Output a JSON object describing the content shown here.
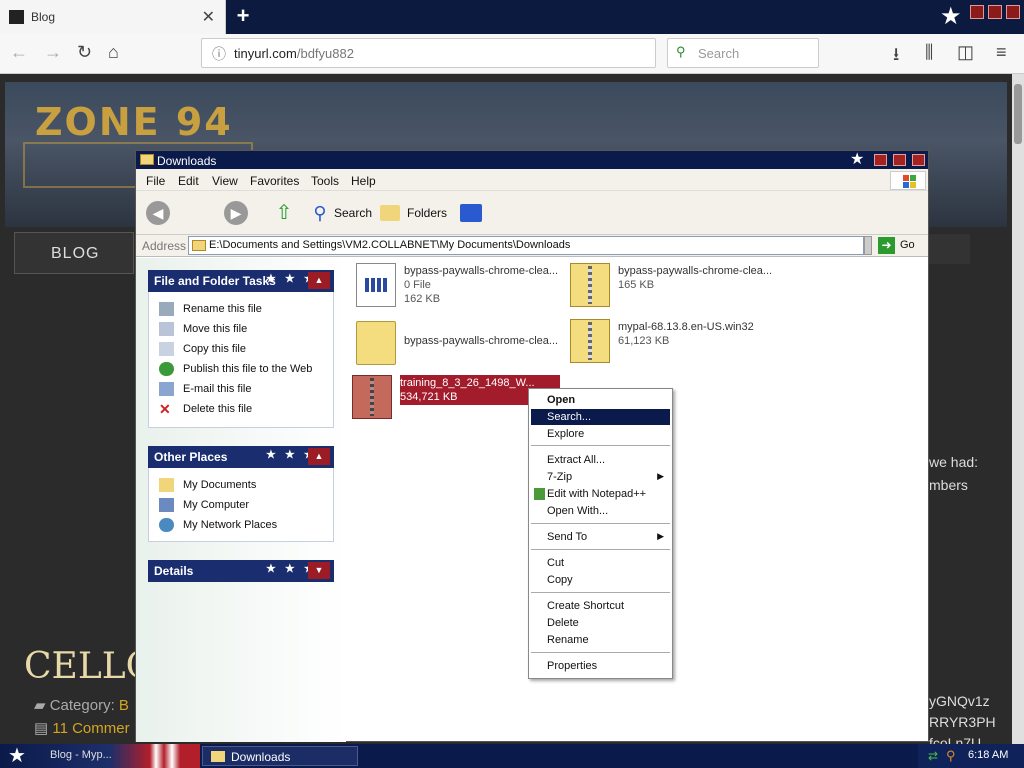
{
  "browser": {
    "tab_title": "Blog",
    "tab_close": "✕",
    "new_tab": "+",
    "url_domain": "tinyurl.com",
    "url_path": "/bdfyu882",
    "search_placeholder": "Search"
  },
  "blog": {
    "logo_text": "ZONE 94",
    "nav_label": "BLOG",
    "post_title": "CELLO C",
    "category_label": "Category: ",
    "category_value": "B",
    "comments": "11 Commer",
    "peek_right": [
      "we had:",
      "mbers",
      "yGNQv1z",
      "RRYR3PH",
      "fcoLn7U"
    ]
  },
  "explorer": {
    "title": "Downloads",
    "menu": [
      "File",
      "Edit",
      "View",
      "Favorites",
      "Tools",
      "Help"
    ],
    "toolbar": {
      "search": "Search",
      "folders": "Folders"
    },
    "address_label": "Address",
    "address_path": "E:\\Documents and Settings\\VM2.COLLABNET\\My Documents\\Downloads",
    "go_label": "Go",
    "file_tasks": {
      "title": "File and Folder Tasks",
      "items": [
        "Rename this file",
        "Move this file",
        "Copy this file",
        "Publish this file to the Web",
        "E-mail this file",
        "Delete this file"
      ]
    },
    "other_places": {
      "title": "Other Places",
      "items": [
        "My Documents",
        "My Computer",
        "My Network Places"
      ]
    },
    "details": {
      "title": "Details"
    },
    "files": [
      {
        "name": "bypass-paywalls-chrome-clea...",
        "meta1": "0 File",
        "meta2": "162 KB",
        "kind": "document"
      },
      {
        "name": "bypass-paywalls-chrome-clea...",
        "meta1": "165 KB",
        "meta2": "",
        "kind": "zip"
      },
      {
        "name": "bypass-paywalls-chrome-clea...",
        "meta1": "",
        "meta2": "",
        "kind": "folder"
      },
      {
        "name": "mypal-68.13.8.en-US.win32",
        "meta1": "61,123 KB",
        "meta2": "",
        "kind": "zip"
      },
      {
        "name": "training_8_3_26_1498_W...",
        "meta1": "534,721 KB",
        "meta2": "",
        "kind": "zip",
        "selected": true
      }
    ]
  },
  "context_menu": {
    "items": [
      "Open",
      "Search...",
      "Explore",
      "Extract All...",
      "7-Zip",
      "Edit with Notepad++",
      "Open With...",
      "Send To",
      "Cut",
      "Copy",
      "Create Shortcut",
      "Delete",
      "Rename",
      "Properties"
    ],
    "highlighted": "Search..."
  },
  "taskbar": {
    "blog_item": "Blog - Myp...",
    "downloads_item": "Downloads",
    "clock": "6:18 AM"
  },
  "colors": {
    "xp_title": "#0a1a4a",
    "panel_head": "#1a2d6e",
    "selection": "#a31c2c",
    "accent_gold": "#c9a040"
  }
}
